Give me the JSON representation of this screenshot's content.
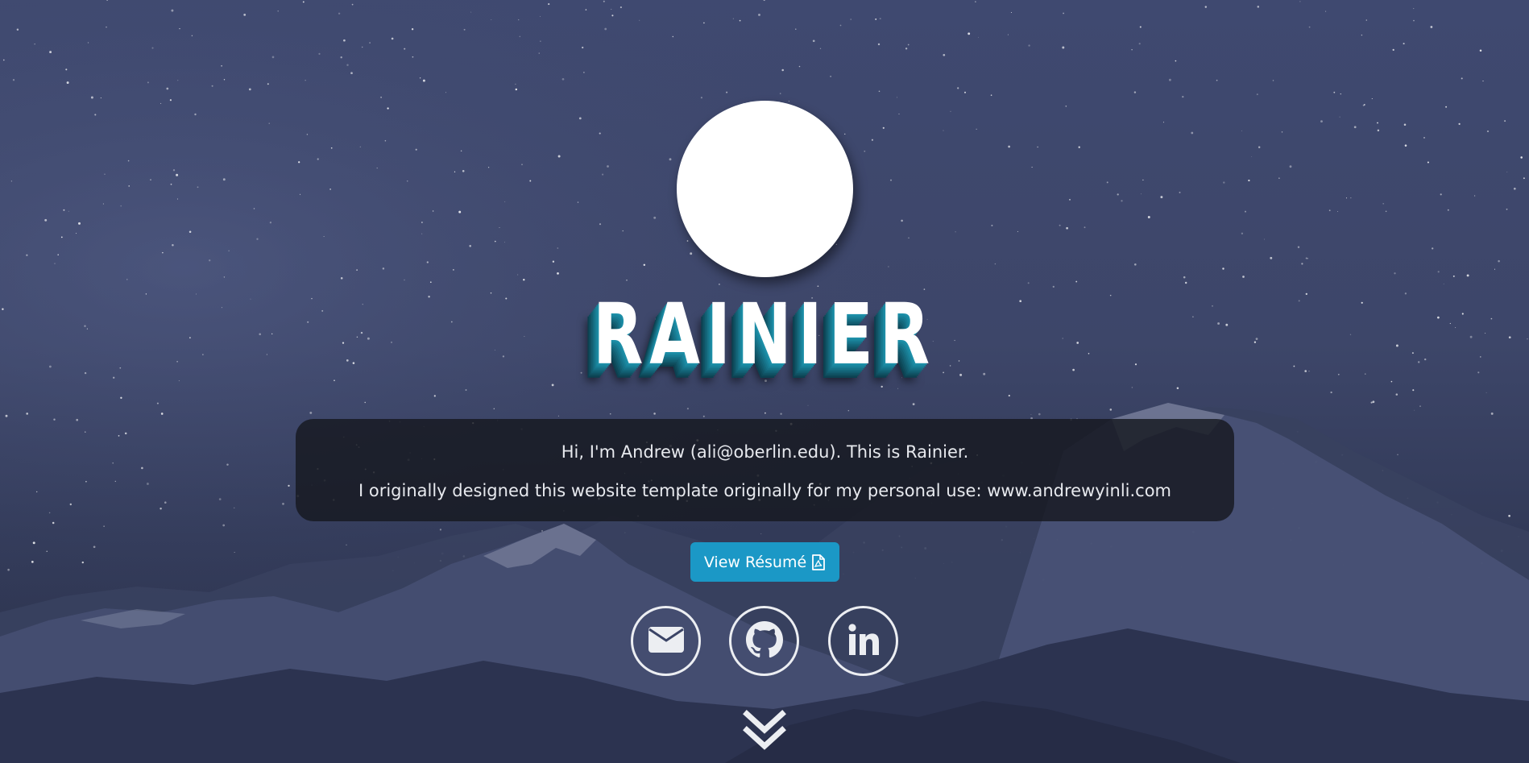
{
  "hero": {
    "title": "RAINIER",
    "intro_line_1": "Hi, I'm Andrew (ali@oberlin.edu). This is Rainier.",
    "intro_line_2": "I originally designed this website template originally for my personal use: www.andrewyinli.com"
  },
  "resume_button": {
    "label": "View Résumé",
    "icon": "file-pdf-icon"
  },
  "social_links": [
    {
      "name": "email",
      "icon": "envelope-icon"
    },
    {
      "name": "github",
      "icon": "github-icon"
    },
    {
      "name": "linkedin",
      "icon": "linkedin-icon"
    }
  ],
  "scroll_indicator": {
    "icon": "double-chevron-down-icon"
  },
  "colors": {
    "accent": "#1b98c6",
    "title_shadow": "#1d8fa8",
    "sky": "#3f4970",
    "mountain": "#2a3049",
    "intro_box": "#16181f"
  }
}
